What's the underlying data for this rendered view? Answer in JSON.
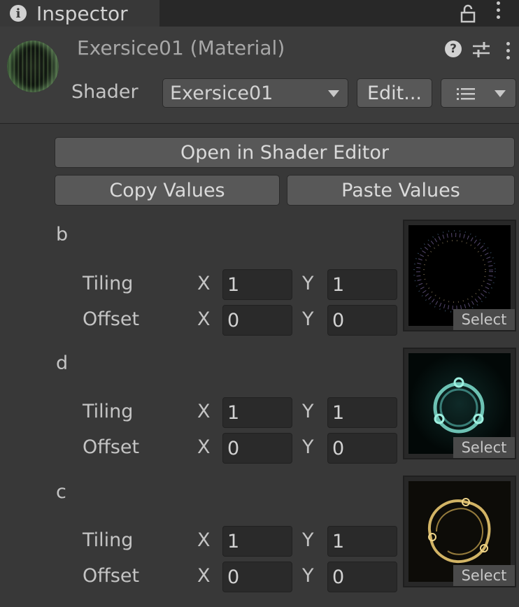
{
  "tab": {
    "title": "Inspector",
    "info_icon": "info-icon",
    "lock_icon": "lock-icon",
    "menu_icon": "kebab-menu-icon"
  },
  "material": {
    "name": "Exersice01 (Material)",
    "shader_label": "Shader",
    "shader_value": "Exersice01",
    "edit_label": "Edit..."
  },
  "buttons": {
    "open_shader_editor": "Open in Shader Editor",
    "copy_values": "Copy Values",
    "paste_values": "Paste Values"
  },
  "properties": [
    {
      "name": "b",
      "tiling_label": "Tiling",
      "offset_label": "Offset",
      "tiling": {
        "x": "1",
        "y": "1"
      },
      "offset": {
        "x": "0",
        "y": "0"
      },
      "select_label": "Select",
      "thumbnail": "ring-particles"
    },
    {
      "name": "d",
      "tiling_label": "Tiling",
      "offset_label": "Offset",
      "tiling": {
        "x": "1",
        "y": "1"
      },
      "offset": {
        "x": "0",
        "y": "0"
      },
      "select_label": "Select",
      "thumbnail": "cyan-ring"
    },
    {
      "name": "c",
      "tiling_label": "Tiling",
      "offset_label": "Offset",
      "tiling": {
        "x": "1",
        "y": "1"
      },
      "offset": {
        "x": "0",
        "y": "0"
      },
      "select_label": "Select",
      "thumbnail": "gold-ring"
    }
  ],
  "axes": {
    "x": "X",
    "y": "Y"
  },
  "colors": {
    "background": "#383838",
    "field": "#2a2a2a",
    "button": "#585858",
    "cyan_glow": "#7fe0d0",
    "gold_glow": "#e8c770"
  }
}
